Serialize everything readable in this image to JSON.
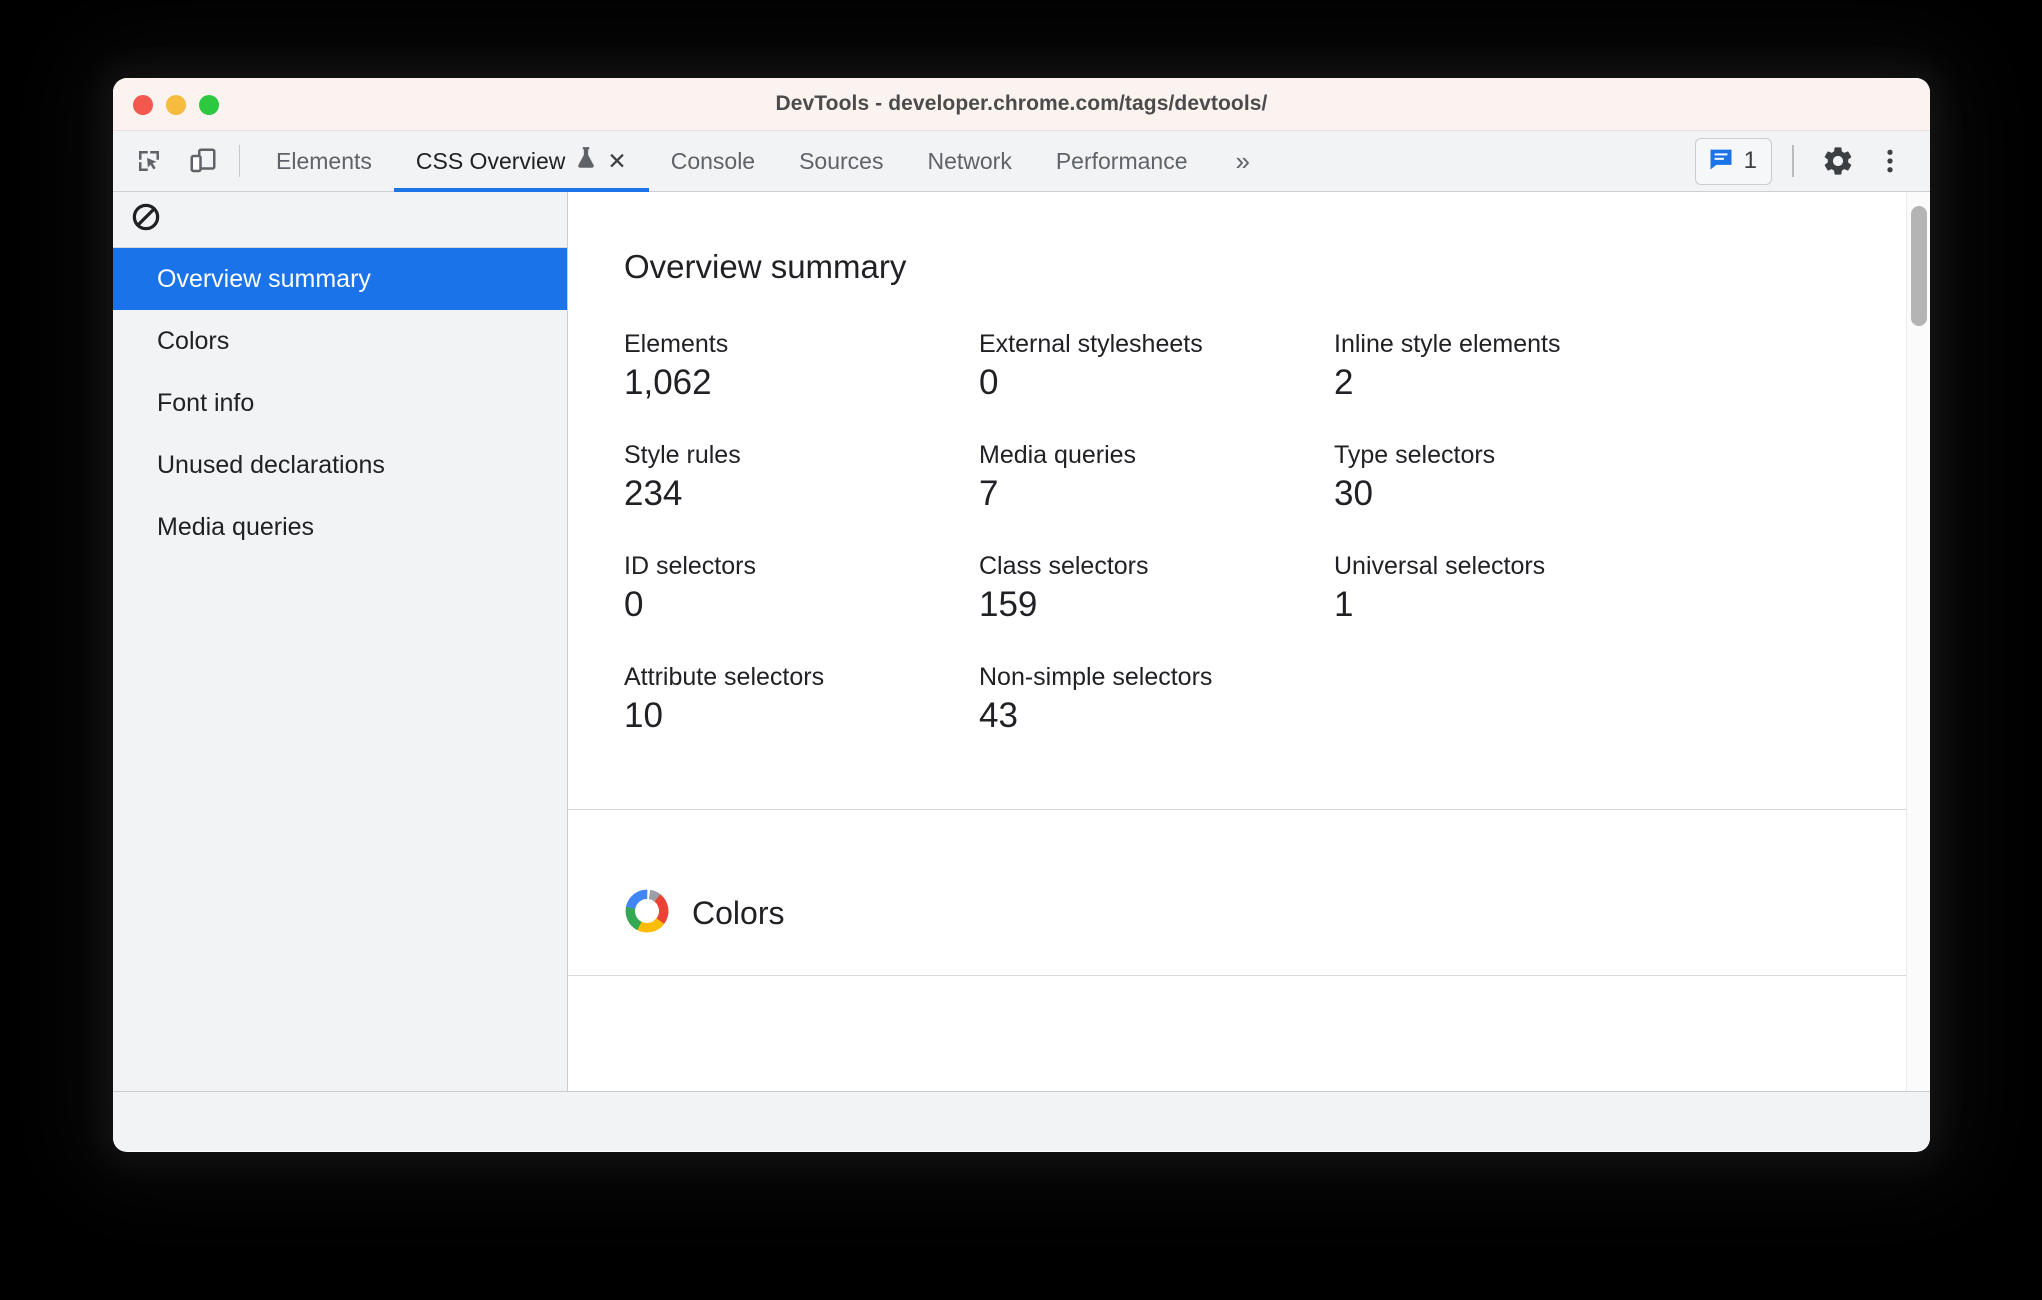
{
  "window": {
    "title": "DevTools - developer.chrome.com/tags/devtools/",
    "traffic_lights": [
      "close-red",
      "minimize-yellow",
      "zoom-green"
    ]
  },
  "toolbar": {
    "inspect_icon": "inspect-element-icon",
    "device_icon": "device-toolbar-icon",
    "overflow_label": "»",
    "messages_count": "1",
    "messages_icon": "message-bubble-icon",
    "settings_icon": "gear-icon",
    "more_icon": "three-dot-menu-icon"
  },
  "tabs": [
    {
      "label": "Elements",
      "selected": false,
      "closable": false
    },
    {
      "label": "CSS Overview",
      "selected": true,
      "closable": true,
      "experimental_icon": "flask-icon",
      "close_label": "✕"
    },
    {
      "label": "Console",
      "selected": false,
      "closable": false
    },
    {
      "label": "Sources",
      "selected": false,
      "closable": false
    },
    {
      "label": "Network",
      "selected": false,
      "closable": false
    },
    {
      "label": "Performance",
      "selected": false,
      "closable": false
    }
  ],
  "sidebar": {
    "clear_icon": "clear-no-entry-icon",
    "items": [
      {
        "label": "Overview summary",
        "selected": true
      },
      {
        "label": "Colors",
        "selected": false
      },
      {
        "label": "Font info",
        "selected": false
      },
      {
        "label": "Unused declarations",
        "selected": false
      },
      {
        "label": "Media queries",
        "selected": false
      }
    ]
  },
  "main": {
    "summary_title": "Overview summary",
    "metrics": [
      {
        "label": "Elements",
        "value": "1,062"
      },
      {
        "label": "External stylesheets",
        "value": "0"
      },
      {
        "label": "Inline style elements",
        "value": "2"
      },
      {
        "label": "Style rules",
        "value": "234"
      },
      {
        "label": "Media queries",
        "value": "7"
      },
      {
        "label": "Type selectors",
        "value": "30"
      },
      {
        "label": "ID selectors",
        "value": "0"
      },
      {
        "label": "Class selectors",
        "value": "159"
      },
      {
        "label": "Universal selectors",
        "value": "1"
      },
      {
        "label": "Attribute selectors",
        "value": "10"
      },
      {
        "label": "Non-simple selectors",
        "value": "43"
      }
    ],
    "colors_section": {
      "title": "Colors",
      "icon": "color-wheel-icon"
    }
  },
  "colors": {
    "accent_blue": "#1a73e8",
    "titlebar_bg": "#fbf3f0",
    "toolbar_bg": "#f1f3f4",
    "text_primary": "#202124",
    "text_secondary": "#5f6368",
    "traffic_red": "#f2584d",
    "traffic_yellow": "#f6bb3f",
    "traffic_green": "#2cc940",
    "wheel_red": "#ea4335",
    "wheel_yellow": "#fbbc05",
    "wheel_green": "#34a853",
    "wheel_blue": "#4285f4",
    "wheel_gray": "#9aa0a6"
  }
}
